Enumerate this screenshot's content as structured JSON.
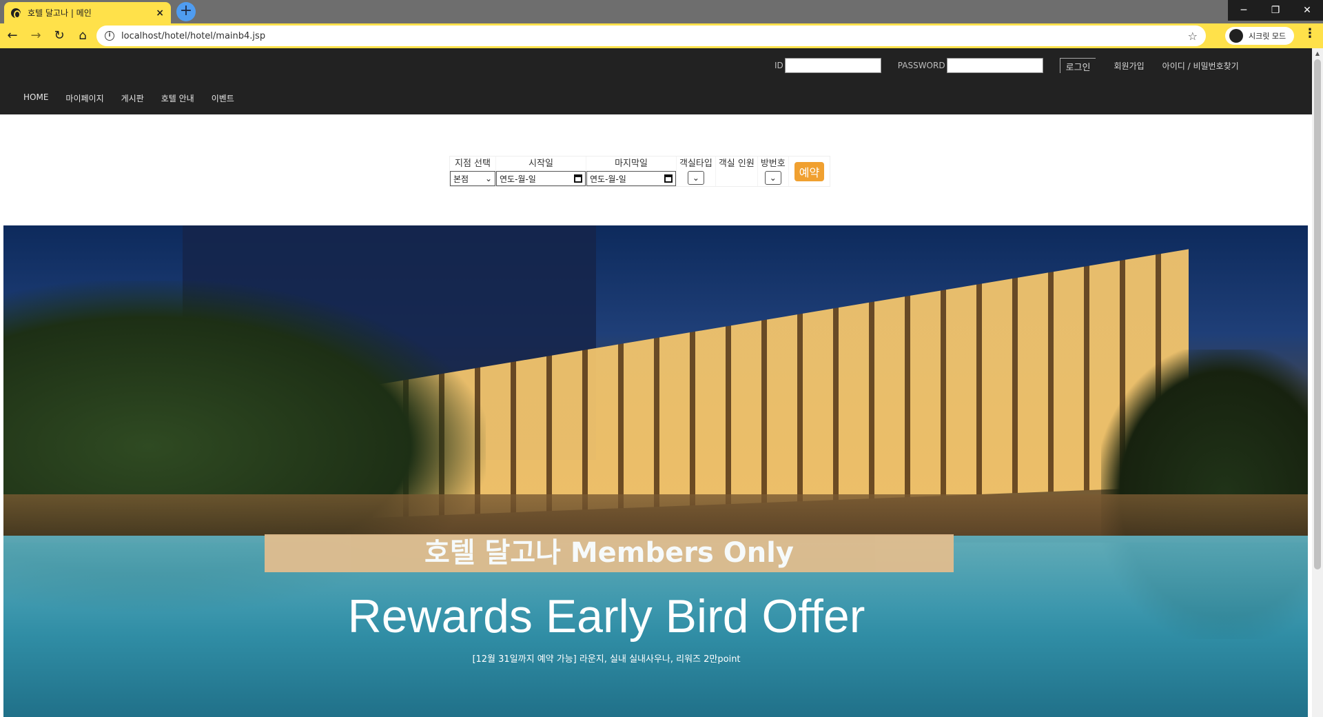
{
  "browser": {
    "tab_title": "호텔 달고나 | 메인",
    "tab_close": "×",
    "new_tab": "+",
    "url": "localhost/hotel/hotel/mainb4.jsp",
    "profile_label": "시크릿 모드",
    "window_controls": {
      "minimize": "─",
      "restore": "❐",
      "close": "✕"
    },
    "accent_color": "#ffe14a"
  },
  "header": {
    "login": {
      "id_label": "ID",
      "password_label": "PASSWORD",
      "login_button": "로그인",
      "signup_link": "회원가입",
      "find_link": "아이디 / 비밀번호찾기"
    },
    "nav": [
      "HOME",
      "마이페이지",
      "게시판",
      "호텔 안내",
      "이벤트"
    ]
  },
  "booking": {
    "branch_label": "지점 선택",
    "branch_value": "본점",
    "start_label": "시작일",
    "start_placeholder": "연도-월-일",
    "end_label": "마지막일",
    "end_placeholder": "연도-월-일",
    "room_type_label": "객실타입",
    "guests_label": "객실 인원",
    "room_no_label": "방번호",
    "reserve_button": "예약",
    "button_color": "#f0a030"
  },
  "hero": {
    "badge": "호텔 달고나 Members Only",
    "headline": "Rewards Early Bird Offer",
    "subtext": "[12월 31일까지 예약 가능] 라운지, 실내 실내사우나, 리워즈 2만point"
  }
}
